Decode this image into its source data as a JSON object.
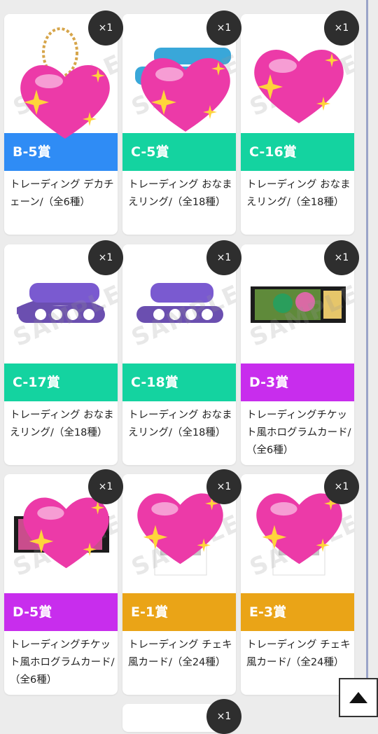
{
  "cards": [
    {
      "prize": "B-5賞",
      "color": "#2f8cf5",
      "desc": "トレーディング デカチェーン/（全6種）",
      "qty": "×1",
      "image": "trading-big-chain",
      "heart": true
    },
    {
      "prize": "C-5賞",
      "color": "#14d3a0",
      "desc": "トレーディング おなまえリング/（全18種）",
      "qty": "×1",
      "image": "name-ring",
      "heart": true
    },
    {
      "prize": "C-16賞",
      "color": "#14d3a0",
      "desc": "トレーディング おなまえリング/（全18種）",
      "qty": "×1",
      "image": "name-ring",
      "heart": true
    },
    {
      "prize": "C-17賞",
      "color": "#14d3a0",
      "desc": "トレーディング おなまえリング/（全18種）",
      "qty": "×1",
      "image": "name-ring-purple",
      "heart": false
    },
    {
      "prize": "C-18賞",
      "color": "#14d3a0",
      "desc": "トレーディング おなまえリング/（全18種）",
      "qty": "×1",
      "image": "name-ring-purple",
      "heart": false
    },
    {
      "prize": "D-3賞",
      "color": "#c82ded",
      "desc": "トレーディングチケット風ホログラムカード/（全6種）",
      "qty": "×1",
      "image": "ticket-hologram-card",
      "heart": false
    },
    {
      "prize": "D-5賞",
      "color": "#c82ded",
      "desc": "トレーディングチケット風ホログラムカード/（全6種）",
      "qty": "×1",
      "image": "ticket-hologram-card",
      "heart": true
    },
    {
      "prize": "E-1賞",
      "color": "#eaa417",
      "desc": "トレーディング チェキ風カード/（全24種）",
      "qty": "×1",
      "image": "instant-photo-card",
      "heart": true
    },
    {
      "prize": "E-3賞",
      "color": "#eaa417",
      "desc": "トレーディング チェキ風カード/（全24種）",
      "qty": "×1",
      "image": "instant-photo-card",
      "heart": true
    },
    {
      "qty": "×1",
      "image": "partial"
    }
  ],
  "watermark": "SAMPLE",
  "scroll_top_icon": "triangle-up-icon"
}
